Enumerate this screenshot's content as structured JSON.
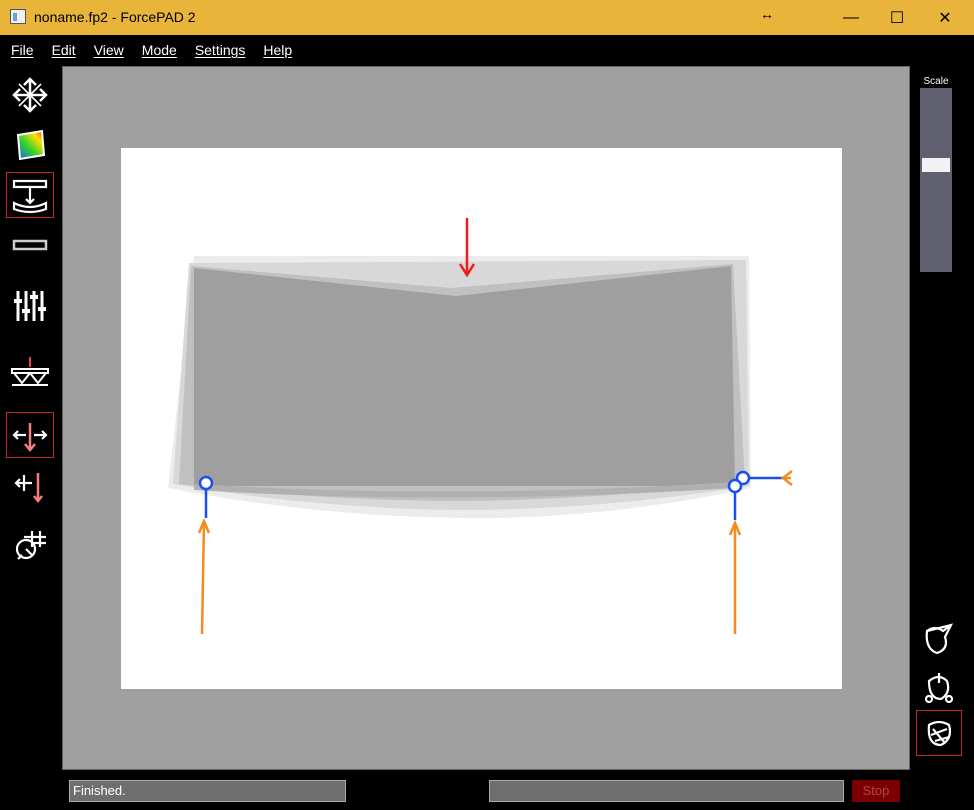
{
  "window": {
    "title": "noname.fp2 - ForcePAD 2",
    "resize_glyph": "↔",
    "minimize": "—",
    "maximize": "☐",
    "close": "✕"
  },
  "menu": {
    "items": [
      "File",
      "Edit",
      "View",
      "Mode",
      "Settings",
      "Help"
    ]
  },
  "left_toolbar": {
    "tools": [
      {
        "name": "cross-arrows-icon",
        "active": false
      },
      {
        "name": "color-gradient-icon",
        "active": false
      },
      {
        "name": "bending-beam-icon",
        "active": true
      },
      {
        "name": "rectangle-outline-icon",
        "active": false
      },
      {
        "name": "sliders-icon",
        "active": false
      },
      {
        "name": "bridge-truss-icon",
        "active": false
      },
      {
        "name": "force-arrows-icon",
        "active": true
      },
      {
        "name": "point-force-icon",
        "active": false
      },
      {
        "name": "target-crosshair-icon",
        "active": false
      }
    ]
  },
  "scale": {
    "label": "Scale",
    "value": 0.37
  },
  "right_toolbar": {
    "tools": [
      {
        "name": "edit-shape-icon",
        "active": false
      },
      {
        "name": "constraint-shape-icon",
        "active": false
      },
      {
        "name": "rotate-shape-icon",
        "active": true
      }
    ]
  },
  "status": {
    "text": "Finished.",
    "stop_label": "Stop",
    "progress": 0
  },
  "colors": {
    "titlebar": "#e8b43a",
    "background": "#000000",
    "canvas": "#a0a0a0",
    "paper": "#ffffff",
    "load_arrow": "#ee1c1c",
    "support_arrow": "#f58a1f",
    "constraint": "#1a4ff0",
    "active_border": "#c0282d"
  }
}
